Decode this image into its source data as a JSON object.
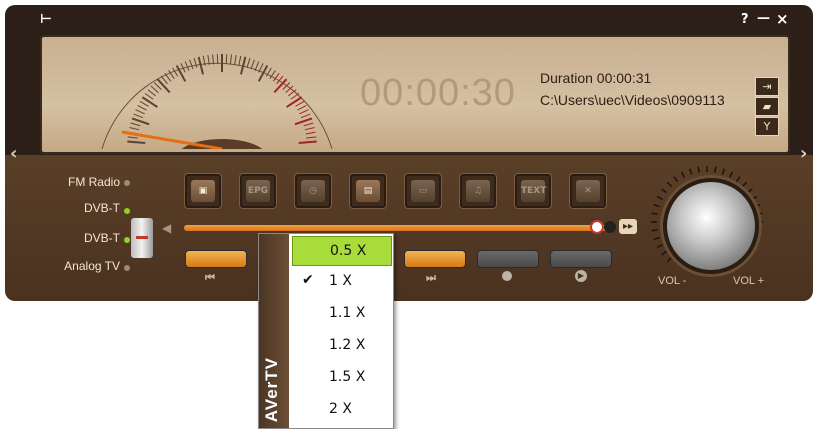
{
  "window": {
    "pin_icon": "pin-icon",
    "help_label": "?",
    "minimize_label": "—",
    "close_label": "×"
  },
  "display": {
    "time": "00:00:30",
    "duration": "Duration 00:00:31",
    "file_path": "C:\\Users\\uec\\Videos\\0909113"
  },
  "sources": [
    {
      "label": "FM Radio",
      "led_color": "#9b8a74"
    },
    {
      "label": "DVB-T",
      "led_color": "#8fd12a"
    },
    {
      "label": "DVB-T",
      "led_color": "#8fd12a"
    },
    {
      "label": "Analog TV",
      "led_color": "#9b8a74"
    }
  ],
  "function_buttons": [
    {
      "icon": "camera-icon"
    },
    {
      "icon": "epg-icon",
      "label": "EPG"
    },
    {
      "icon": "clock-icon"
    },
    {
      "icon": "video-play-icon"
    },
    {
      "icon": "tv-icon"
    },
    {
      "icon": "music-icon"
    },
    {
      "icon": "teletext-icon",
      "label": "TEXT"
    },
    {
      "icon": "settings-tools-icon"
    }
  ],
  "volume": {
    "minus_label": "VOL -",
    "plus_label": "VOL +"
  },
  "speed_menu": {
    "brand": "AVerTV",
    "items": [
      {
        "label": "0.5 X",
        "checked": false,
        "highlighted": true
      },
      {
        "label": "1 X",
        "checked": true,
        "highlighted": false
      },
      {
        "label": "1.1 X",
        "checked": false,
        "highlighted": false
      },
      {
        "label": "1.2 X",
        "checked": false,
        "highlighted": false
      },
      {
        "label": "1.5 X",
        "checked": false,
        "highlighted": false
      },
      {
        "label": "2 X",
        "checked": false,
        "highlighted": false
      }
    ],
    "check_glyph": "✔"
  },
  "colors": {
    "accent_orange": "#e8891f",
    "menu_highlight": "#a8dc3a"
  }
}
